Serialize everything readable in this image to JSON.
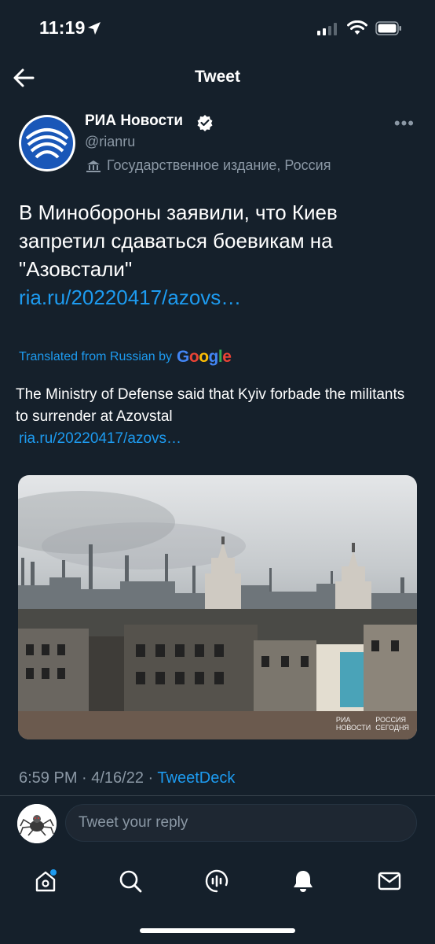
{
  "status_bar": {
    "time": "11:19"
  },
  "nav": {
    "title": "Tweet"
  },
  "tweet": {
    "author_name": "РИА Новости",
    "handle": "@rianru",
    "label": "Государственное издание, Россия",
    "text": "В Минобороны заявили, что Киев запретил сдаваться боевикам на \"Азовстали\"",
    "link": "ria.ru/20220417/azovs…",
    "translated_prefix": "Translated from Russian by",
    "translated_provider": "Google",
    "translation_text": "The Ministry of Defense said that Kyiv forbade the militants to surrender at Azovstal",
    "translation_link": "ria.ru/20220417/azovs…",
    "media_watermark_left": "РИА\nНОВОСТИ",
    "media_watermark_right": "РОССИЯ\nСЕГОДНЯ",
    "time": "6:59 PM · 4/16/22 · ",
    "source": "TweetDeck"
  },
  "reply": {
    "placeholder": "Tweet your reply"
  },
  "colors": {
    "background": "#15202b",
    "accent": "#1d9bf0",
    "muted": "#8b98a5"
  },
  "icons": [
    "location-arrow-icon",
    "signal-icon",
    "wifi-icon",
    "battery-icon",
    "back-arrow-icon",
    "verified-badge-icon",
    "government-building-icon",
    "more-icon",
    "home-icon",
    "search-icon",
    "spaces-icon",
    "notifications-icon",
    "messages-icon"
  ]
}
